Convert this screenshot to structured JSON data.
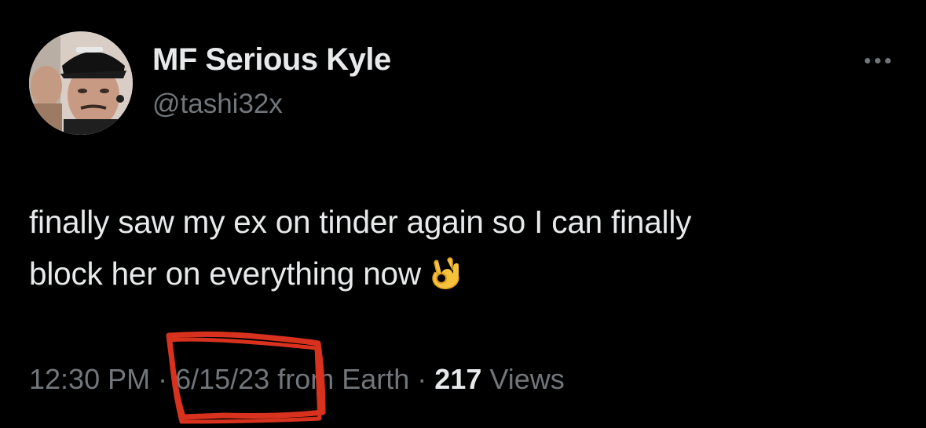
{
  "tweet": {
    "author": {
      "display_name": "MF Serious Kyle",
      "handle": "@tashi32x",
      "avatar_icon": "profile-photo"
    },
    "more_icon": "more-options-icon",
    "text_line_1": "finally saw my ex on tinder again so I can finally",
    "text_line_2": "block her on everything now",
    "emoji": "ok-hand-emoji",
    "meta": {
      "time": "12:30 PM",
      "separator_1": " · ",
      "date": "6/15/23",
      "location": " from Earth",
      "separator_2": " · ",
      "views_count": "217",
      "views_label": " Views"
    }
  },
  "colors": {
    "background": "#000000",
    "primary_text": "#e7e9ea",
    "secondary_text": "#71767b",
    "annotation": "#d8321e"
  }
}
